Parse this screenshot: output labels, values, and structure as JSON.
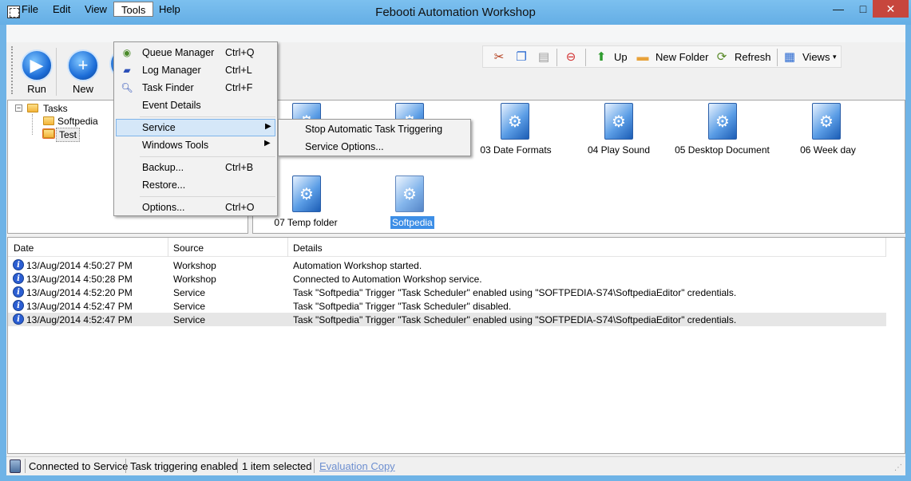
{
  "window": {
    "title": "Febooti Automation Workshop",
    "minimize_glyph": "—",
    "maximize_glyph": "□",
    "close_glyph": "✕"
  },
  "menubar": {
    "file": "File",
    "edit": "Edit",
    "view": "View",
    "tools": "Tools",
    "help": "Help"
  },
  "toolbar_left": {
    "run": "Run",
    "new": "New"
  },
  "toolbar_right": {
    "up": "Up",
    "new_folder": "New Folder",
    "refresh": "Refresh",
    "views": "Views"
  },
  "tree": {
    "root": "Tasks",
    "children": [
      "Softpedia",
      "Test"
    ]
  },
  "files": {
    "items": [
      "03 Date Formats",
      "04 Play Sound",
      "05 Desktop Document",
      "06 Week day",
      "07 Temp folder",
      "Softpedia"
    ]
  },
  "tools_menu": {
    "items": [
      {
        "label": "Queue Manager",
        "shortcut": "Ctrl+Q"
      },
      {
        "label": "Log Manager",
        "shortcut": "Ctrl+L"
      },
      {
        "label": "Task Finder",
        "shortcut": "Ctrl+F"
      },
      {
        "label": "Event Details",
        "shortcut": ""
      },
      {
        "label": "Service",
        "shortcut": ""
      },
      {
        "label": "Windows Tools",
        "shortcut": ""
      },
      {
        "label": "Backup...",
        "shortcut": "Ctrl+B"
      },
      {
        "label": "Restore...",
        "shortcut": ""
      },
      {
        "label": "Options...",
        "shortcut": "Ctrl+O"
      }
    ]
  },
  "service_submenu": {
    "items": [
      "Stop Automatic Task Triggering",
      "Service Options..."
    ]
  },
  "log": {
    "columns": [
      "Date",
      "Source",
      "Details"
    ],
    "rows": [
      {
        "date": "13/Aug/2014 4:50:27 PM",
        "source": "Workshop",
        "details": "Automation Workshop started."
      },
      {
        "date": "13/Aug/2014 4:50:28 PM",
        "source": "Workshop",
        "details": "Connected to Automation Workshop service."
      },
      {
        "date": "13/Aug/2014 4:52:20 PM",
        "source": "Service",
        "details": "Task \"Softpedia\" Trigger \"Task Scheduler\" enabled using \"SOFTPEDIA-S74\\SoftpediaEditor\" credentials."
      },
      {
        "date": "13/Aug/2014 4:52:47 PM",
        "source": "Service",
        "details": "Task \"Softpedia\" Trigger \"Task Scheduler\" disabled."
      },
      {
        "date": "13/Aug/2014 4:52:47 PM",
        "source": "Service",
        "details": "Task \"Softpedia\" Trigger \"Task Scheduler\" enabled using \"SOFTPEDIA-S74\\SoftpediaEditor\" credentials."
      }
    ]
  },
  "statusbar": {
    "connection": "Connected to Service",
    "triggering": "Task triggering enabled",
    "selection": "1 item selected",
    "link": "Evaluation Copy"
  },
  "colors": {
    "titlebar": "#6fb3e6",
    "close_button": "#c7463d",
    "menu_highlight": "#d5e7f8"
  }
}
